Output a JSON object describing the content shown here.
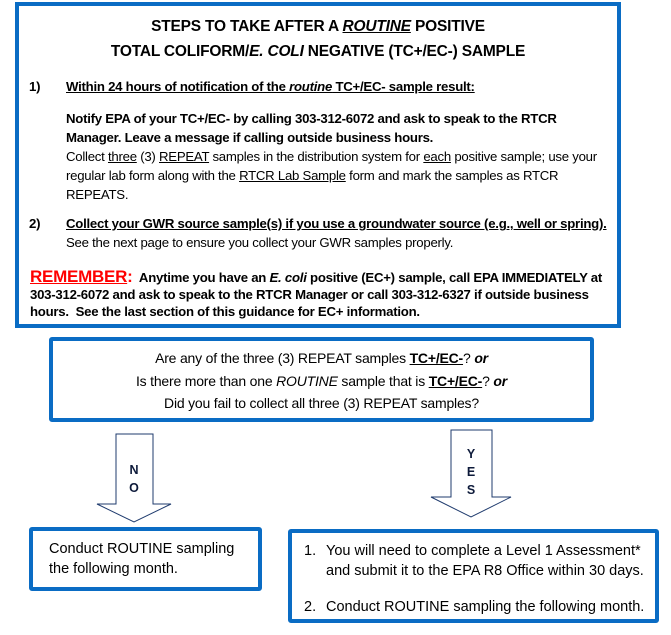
{
  "main": {
    "title_line1_prefix": "STEPS TO TAKE AFTER A ",
    "title_line1_emph": "ROUTINE",
    "title_line1_suffix": " POSITIVE",
    "title_line2_prefix": "TOTAL COLIFORM/",
    "title_line2_emph": "E. COLI",
    "title_line2_suffix": " NEGATIVE (TC+/EC-) SAMPLE",
    "step1": {
      "number": "1)",
      "heading_prefix": "Within 24 hours of notification of the ",
      "heading_emph": "routine",
      "heading_suffix": " TC+/EC- sample result:",
      "notify": "Notify EPA of your TC+/EC- by calling 303-312-6072 and ask to speak to the RTCR Manager. Leave a message if calling outside business hours.",
      "collect_a": "Collect ",
      "collect_three": "three",
      "collect_b": " (3) ",
      "collect_repeat": "REPEAT",
      "collect_c": " samples in the distribution system for ",
      "collect_each": "each",
      "collect_d": " positive sample; use your regular lab form along with the ",
      "collect_form": "RTCR Lab Sample",
      "collect_e": " form and mark the samples as RTCR REPEATS."
    },
    "step2": {
      "number": "2)",
      "heading": "Collect your GWR source sample(s) if you use a groundwater source (e.g., well or spring).",
      "body": "  See the next page to ensure you collect your GWR samples properly."
    },
    "remember": {
      "label": "REMEMBER",
      "colon": ":",
      "text_a": "  Anytime you have an ",
      "text_emph": "E. coli",
      "text_b": " positive (EC+) sample, call EPA IMMEDIATELY at 303-312-6072 and ask to speak to the RTCR Manager or call 303-312-6327 if outside business hours.  See the last section of this guidance for EC+ information."
    }
  },
  "question": {
    "line1_a": "Are any of the three (3) REPEAT samples ",
    "line1_b": "TC+/EC-",
    "line1_c": "? ",
    "line1_or": "or",
    "line2_a": "Is there more than one ",
    "line2_emph": "ROUTINE",
    "line2_b": " sample that is ",
    "line2_c": "TC+/EC-",
    "line2_d": "? ",
    "line2_or": "or",
    "line3": "Did you fail to collect all three (3) REPEAT samples?"
  },
  "arrows": {
    "no": [
      "N",
      "O"
    ],
    "yes": [
      "Y",
      "E",
      "S"
    ]
  },
  "no_outcome": {
    "text": "Conduct ROUTINE sampling the following month."
  },
  "yes_outcome": {
    "items": [
      {
        "num": "1.",
        "text": "You will need to complete a Level 1 Assessment* and submit it to the EPA R8 Office within 30 days."
      },
      {
        "num": "2.",
        "text": "Conduct ROUTINE sampling the following month."
      }
    ]
  },
  "colors": {
    "border": "#0a6cc4",
    "remember": "#ff0000",
    "arrow_stroke": "#1f3b6e"
  }
}
